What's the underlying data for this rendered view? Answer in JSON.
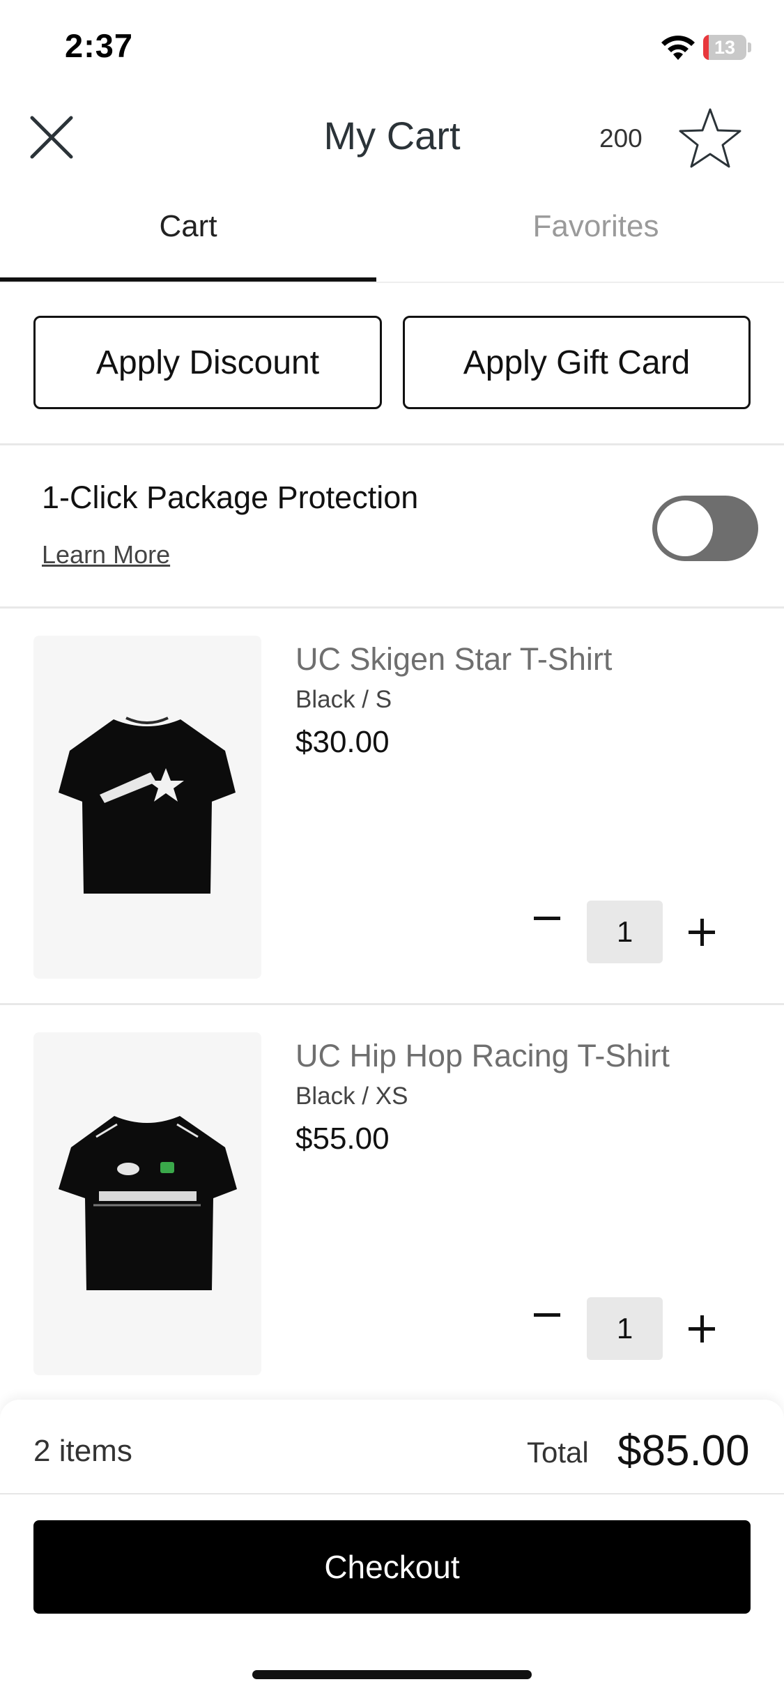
{
  "status_bar": {
    "time": "2:37",
    "battery": "13",
    "battery_level": 0.13,
    "battery_color": "#e8383d"
  },
  "header": {
    "title": "My Cart",
    "points": "200",
    "close_icon": "close-icon",
    "star_icon": "star-icon"
  },
  "tabs": [
    {
      "label": "Cart",
      "active": true
    },
    {
      "label": "Favorites",
      "active": false
    }
  ],
  "actions": {
    "discount": "Apply Discount",
    "gift_card": "Apply Gift Card"
  },
  "protection": {
    "title": "1-Click Package Protection",
    "learn_more": "Learn More",
    "enabled": false
  },
  "items": [
    {
      "name": "UC Skigen Star T-Shirt",
      "variant": "Black / S",
      "price": "$30.00",
      "quantity": "1"
    },
    {
      "name": "UC Hip Hop Racing T-Shirt",
      "variant": "Black / XS",
      "price": "$55.00",
      "quantity": "1"
    }
  ],
  "summary": {
    "count": "2 items",
    "total_label": "Total",
    "total": "$85.00"
  },
  "checkout_label": "Checkout",
  "colors": {
    "accent": "#000000",
    "toggle_off": "#6e6e6e"
  }
}
